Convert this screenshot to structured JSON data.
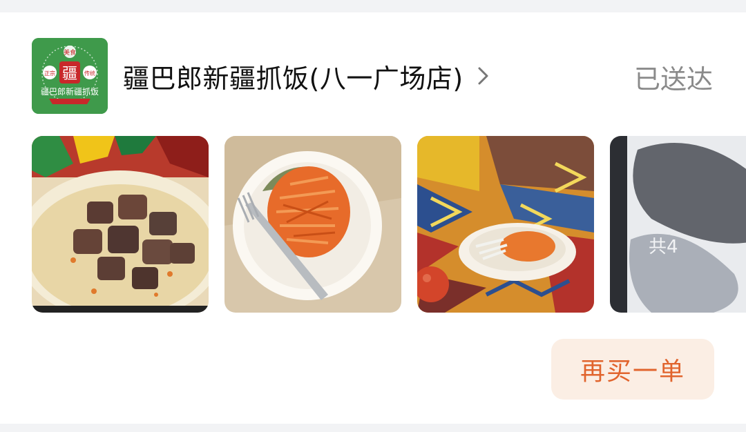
{
  "order": {
    "store": {
      "name": "疆巴郎新疆抓饭(八一广场店)",
      "logo": {
        "icon": "store-logo-icon",
        "badge_char": "疆",
        "left_tag": "正宗",
        "right_tag": "传统",
        "top_tag": "美食",
        "brand_text": "疆巴郎新疆抓饭",
        "colors": {
          "background": "#3f9a4b",
          "badge": "#c8282a",
          "ribbon": "#c8282a"
        }
      }
    },
    "status": "已送达",
    "products": [
      {
        "icon": "lamb-pilaf-image"
      },
      {
        "icon": "carrot-salad-image"
      },
      {
        "icon": "carrot-dish-on-textile-image"
      },
      {
        "icon": "more-products-image",
        "more_label": "共4"
      }
    ],
    "reorder_label": "再买一单"
  },
  "theme": {
    "accent": "#e1642d",
    "button_bg": "#fbeee4",
    "status_color": "#8a8a8a",
    "text_color": "#111111",
    "page_bg": "#f2f3f5"
  }
}
